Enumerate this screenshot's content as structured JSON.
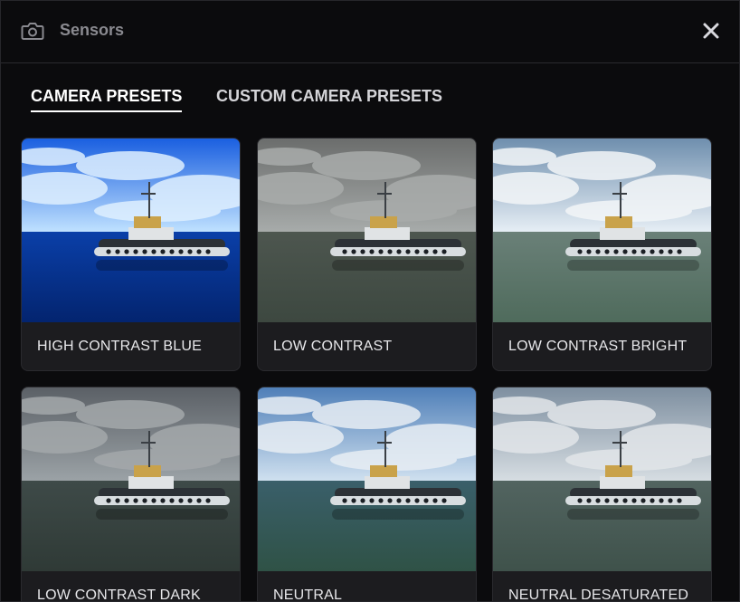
{
  "window": {
    "title": "Sensors",
    "camera_icon": "camera-icon",
    "close_icon": "close-icon"
  },
  "tabs": [
    {
      "label": "CAMERA PRESETS",
      "active": true
    },
    {
      "label": "CUSTOM CAMERA PRESETS",
      "active": false
    }
  ],
  "presets": [
    {
      "label": "HIGH CONTRAST BLUE",
      "sky_top": "#1a5fe0",
      "sky_bottom": "#bfe1ff",
      "water_top": "#0a3fa8",
      "water_bottom": "#03246f",
      "cloud": "#dff0ff"
    },
    {
      "label": "LOW CONTRAST",
      "sky_top": "#6b6d6c",
      "sky_bottom": "#a7abaa",
      "water_top": "#4d564f",
      "water_bottom": "#3d4840",
      "cloud": "#a9acab"
    },
    {
      "label": "LOW CONTRAST BRIGHT",
      "sky_top": "#6f8fae",
      "sky_bottom": "#e6eef5",
      "water_top": "#6a8078",
      "water_bottom": "#4f6b5c",
      "cloud": "#f3f6f8"
    },
    {
      "label": "LOW CONTRAST DARK",
      "sky_top": "#5b6066",
      "sky_bottom": "#9ba2a6",
      "water_top": "#3e4a48",
      "water_bottom": "#2f3a36",
      "cloud": "#a4a8ab"
    },
    {
      "label": "NEUTRAL",
      "sky_top": "#4f7fb8",
      "sky_bottom": "#cfe0ef",
      "water_top": "#3a5f6a",
      "water_bottom": "#2f5246",
      "cloud": "#e8eef4"
    },
    {
      "label": "NEUTRAL DESATURATED",
      "sky_top": "#7e8fa0",
      "sky_bottom": "#d6dde2",
      "water_top": "#526460",
      "water_bottom": "#3f524b",
      "cloud": "#e2e6e9"
    }
  ]
}
